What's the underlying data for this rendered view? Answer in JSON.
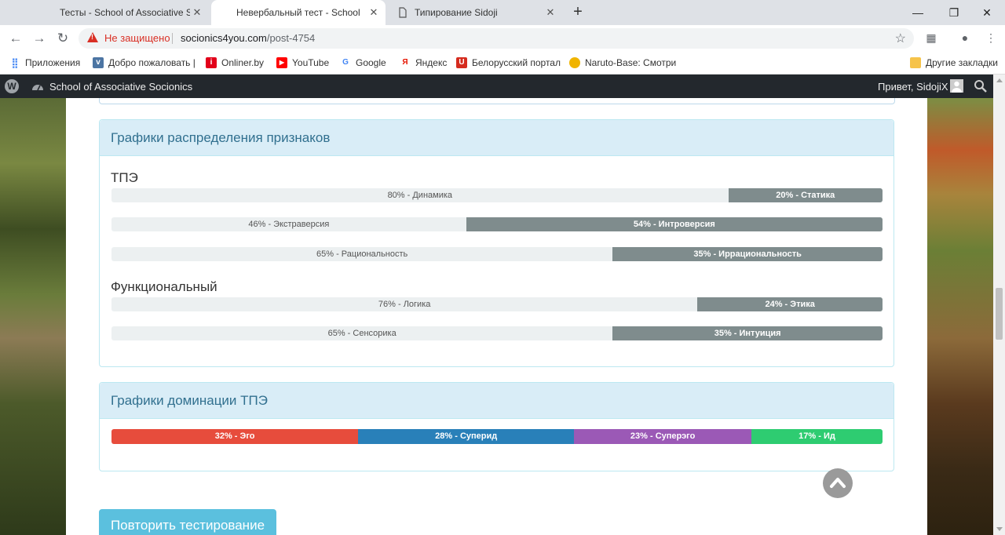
{
  "browser": {
    "tabs": [
      {
        "title": "Тесты - School of Associative Soc"
      },
      {
        "title": "Невербальный тест - School of"
      },
      {
        "title": "Типирование Sidoji"
      }
    ],
    "insecure_label": "Не защищено",
    "url_host": "socionics4you.com",
    "url_path": "/post-4754",
    "bookmarks": [
      {
        "label": "Приложения"
      },
      {
        "label": "Добро пожаловать |"
      },
      {
        "label": "Onliner.by"
      },
      {
        "label": "YouTube"
      },
      {
        "label": "Google"
      },
      {
        "label": "Яндекс"
      },
      {
        "label": "Белорусский портал"
      },
      {
        "label": "Naruto-Base: Смотри"
      },
      {
        "label": "Другие закладки"
      }
    ]
  },
  "adminbar": {
    "site_name": "School of Associative Socionics",
    "greeting": "Привет, SidojiX"
  },
  "distribution": {
    "heading": "Графики распределения признаков",
    "groups": [
      {
        "title": "ТПЭ",
        "bars": [
          {
            "left_label": "80% - Динамика",
            "left_pct": 80,
            "right_label": "20% - Статика",
            "right_pct": 20
          },
          {
            "left_label": "46% - Экстраверсия",
            "left_pct": 46,
            "right_label": "54% - Интроверсия",
            "right_pct": 54
          },
          {
            "left_label": "65% - Рациональность",
            "left_pct": 65,
            "right_label": "35% - Иррациональность",
            "right_pct": 35
          }
        ]
      },
      {
        "title": "Функциональный",
        "bars": [
          {
            "left_label": "76% - Логика",
            "left_pct": 76,
            "right_label": "24% - Этика",
            "right_pct": 24
          },
          {
            "left_label": "65% - Сенсорика",
            "left_pct": 65,
            "right_label": "35% - Интуиция",
            "right_pct": 35
          }
        ]
      }
    ]
  },
  "domination": {
    "heading": "Графики доминации ТПЭ",
    "segments": [
      {
        "label": "32% - Эго",
        "pct": 32,
        "color": "#e74c3c"
      },
      {
        "label": "28% - Суперид",
        "pct": 28,
        "color": "#2980b9"
      },
      {
        "label": "23% - Суперэго",
        "pct": 23,
        "color": "#9b59b6"
      },
      {
        "label": "17% - Ид",
        "pct": 17,
        "color": "#2ecc71"
      }
    ]
  },
  "retry_button": "Повторить тестирование"
}
